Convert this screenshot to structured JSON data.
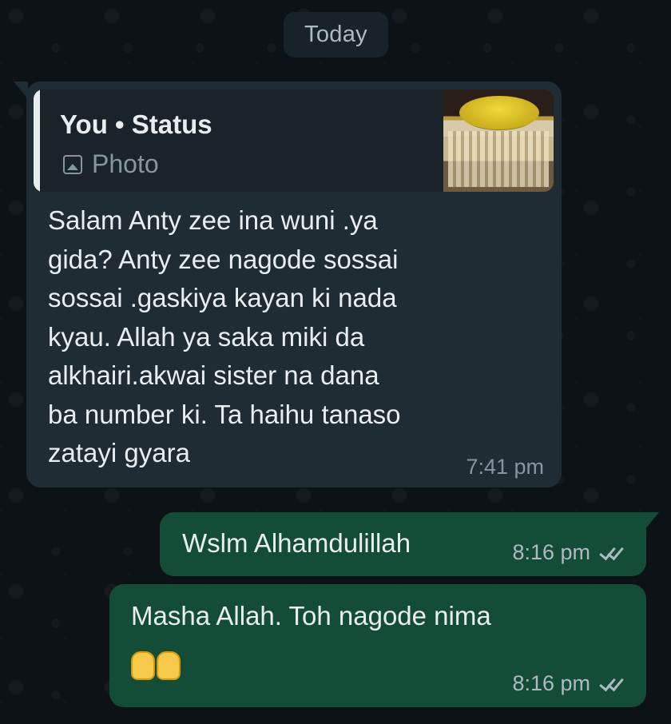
{
  "date_divider": "Today",
  "incoming": {
    "quote": {
      "author": "You • Status",
      "type_label": "Photo",
      "thumbnail_icon": "photo-icon"
    },
    "text": "Salam Anty zee ina wuni .ya\ngida? Anty zee nagode sossai\nsossai .gaskiya kayan ki nada\nkyau. Allah ya saka miki da\nalkhairi.akwai sister na dana\nba number ki. Ta haihu tanaso\nzatayi gyara",
    "time": "7:41 pm"
  },
  "outgoing": [
    {
      "text": "Wslm Alhamdulillah",
      "time": "8:16 pm",
      "status": "read-double-check"
    },
    {
      "text": "Masha Allah. Toh nagode nima",
      "emoji": "🤲",
      "time": "8:16 pm",
      "status": "read-double-check"
    }
  ],
  "colors": {
    "background": "#0b1014",
    "incoming_bubble": "#202c33",
    "outgoing_bubble": "#144d37",
    "meta_text": "#8696a0"
  }
}
